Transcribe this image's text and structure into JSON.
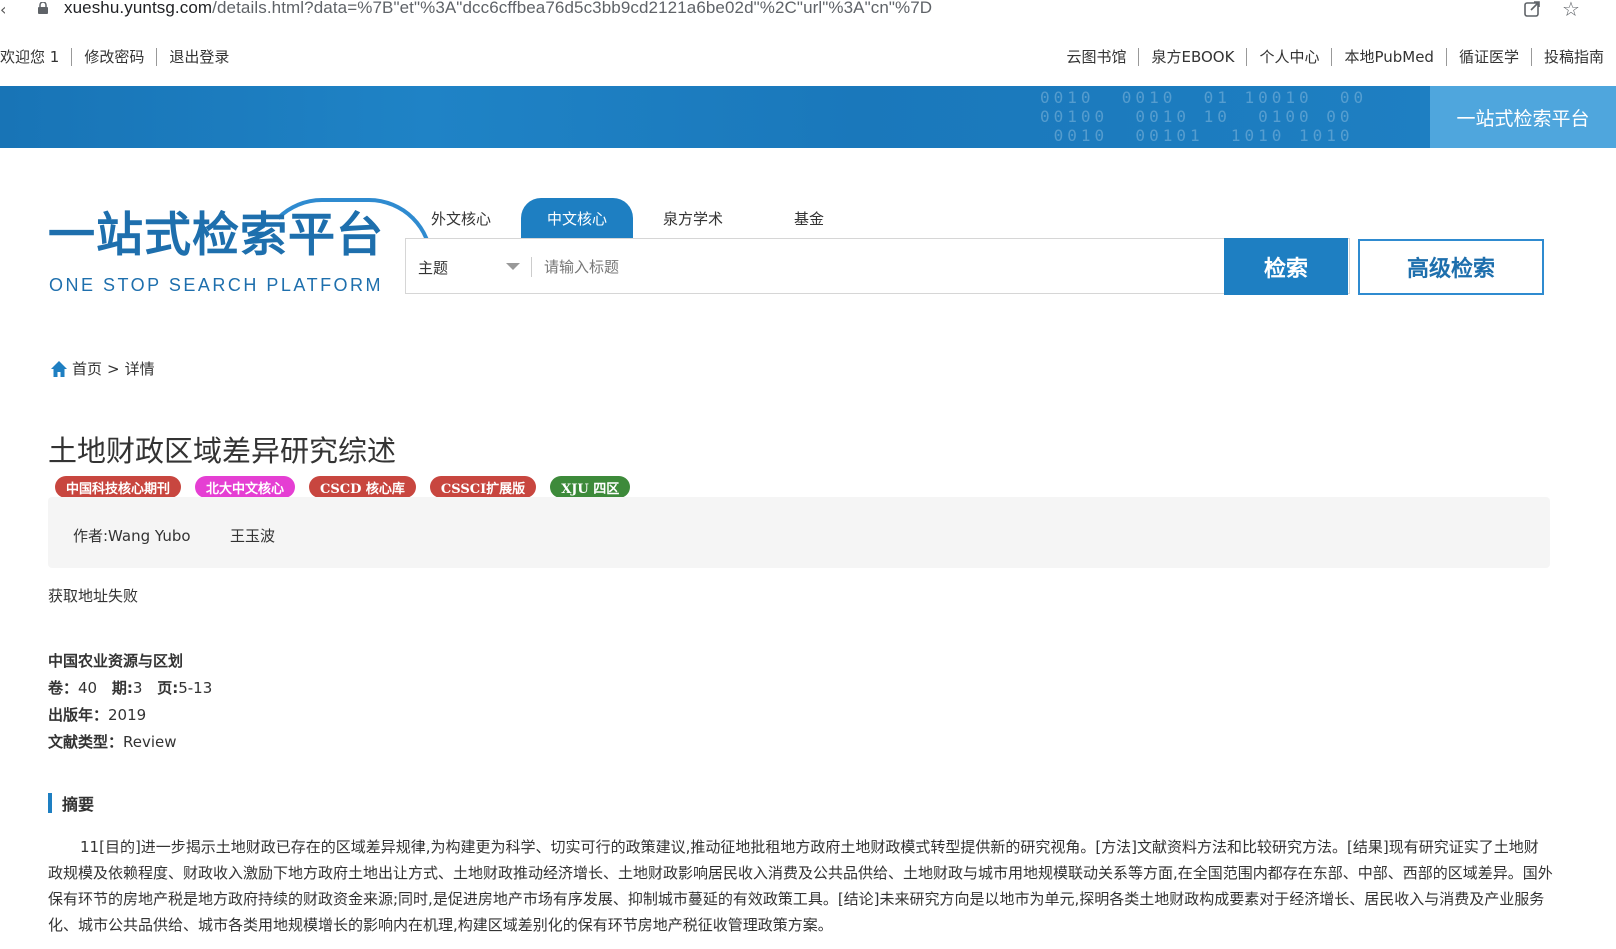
{
  "browser": {
    "url_host": "xueshu.yuntsg.com",
    "url_path": "/details.html?data=%7B\"et\"%3A\"dcc6cffbea76d5c3bb9cd2121a6be02d\"%2C\"url\"%3A\"cn\"%7D"
  },
  "topbar": {
    "left_links": [
      "欢迎您 1",
      "修改密码",
      "退出登录"
    ],
    "right_links": [
      "云图书馆",
      "泉方EBOOK",
      "个人中心",
      "本地PubMed",
      "循证医学",
      "投稿指南"
    ]
  },
  "banner": {
    "platform_label": "一站式检索平台",
    "digits": "0010  0010  01 10010  00\n00100  0010 10  0100 00\n 0010  00101  1010 1010"
  },
  "logo": {
    "cn": "一站式检索平台",
    "en": "ONE STOP SEARCH PLATFORM"
  },
  "tabs": [
    {
      "label": "外文核心",
      "active": false
    },
    {
      "label": "中文核心",
      "active": true
    },
    {
      "label": "泉方学术",
      "active": false
    },
    {
      "label": "基金",
      "active": false
    }
  ],
  "search": {
    "field_select": "主题",
    "placeholder": "请输入标题",
    "search_button": "检索",
    "advanced_button": "高级检索"
  },
  "breadcrumb": {
    "home": "首页",
    "sep": ">",
    "current": "详情"
  },
  "article": {
    "title": "土地财政区域差异研究综述",
    "badges": [
      {
        "label": "中国科技核心期刊",
        "color": "#c8463f"
      },
      {
        "label": "北大中文核心",
        "color": "#e53fd3"
      },
      {
        "label": "CSCD 核心库",
        "color": "#c8463f"
      },
      {
        "label": "CSSCI扩展版",
        "color": "#c8463f"
      },
      {
        "label": "XJU 四区",
        "color": "#3d8a3a"
      }
    ],
    "authors_line1": "作者:Wang Yubo",
    "authors_line2": "王玉波",
    "fail_text": "获取地址失败",
    "journal": "中国农业资源与区划",
    "volume_label": "卷：",
    "volume": "40",
    "issue_label": "期:",
    "issue": "3",
    "pages_label": "页:",
    "pages": "5-13",
    "year_label": "出版年：",
    "year": "2019",
    "type_label": "文献类型：",
    "type": "Review",
    "abstract_heading": "摘要",
    "abstract": "11[目的]进一步揭示土地财政已存在的区域差异规律,为构建更为科学、切实可行的政策建议,推动征地批租地方政府土地财政模式转型提供新的研究视角。[方法]文献资料方法和比较研究方法。[结果]现有研究证实了土地财政规模及依赖程度、财政收入激励下地方政府土地出让方式、土地财政推动经济增长、土地财政影响居民收入消费及公共品供给、土地财政与城市用地规模联动关系等方面,在全国范围内都存在东部、中部、西部的区域差异。国外保有环节的房地产税是地方政府持续的财政资金来源;同时,是促进房地产市场有序发展、抑制城市蔓延的有效政策工具。[结论]未来研究方向是以地市为单元,探明各类土地财政构成要素对于经济增长、居民收入与消费及产业服务化、城市公共品供给、城市各类用地规模增长的影响内在机理,构建区域差别化的保有环节房地产税征收管理政策方案。"
  },
  "colors": {
    "primary": "#1e7fc2",
    "banner_accent": "#4fa6dd"
  }
}
